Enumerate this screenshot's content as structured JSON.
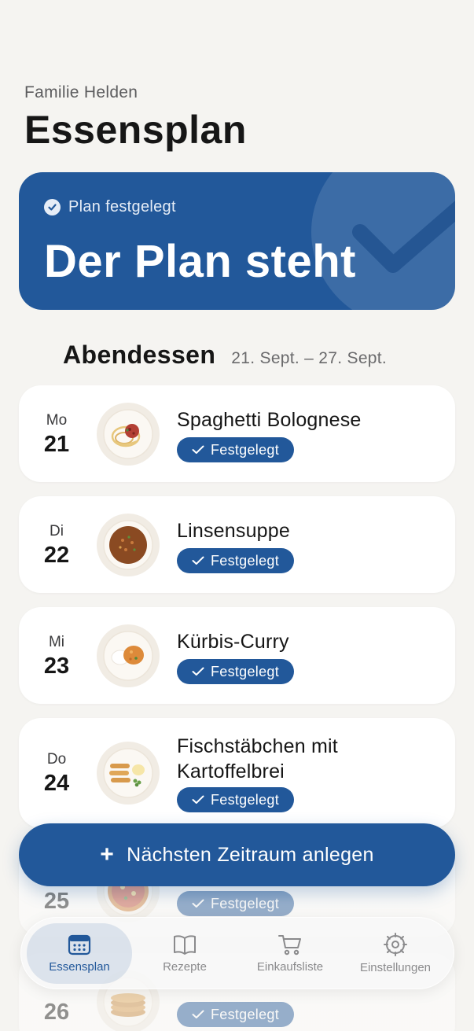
{
  "header": {
    "household": "Familie Helden",
    "title": "Essensplan"
  },
  "hero": {
    "status": "Plan festgelegt",
    "heading": "Der Plan steht"
  },
  "section": {
    "title": "Abendessen",
    "range": "21. Sept. – 27. Sept."
  },
  "meals": [
    {
      "day": "Mo",
      "date": "21",
      "name": "Spaghetti Bolognese",
      "badge": "Festgelegt",
      "plate_icon": "spaghetti-plate-icon"
    },
    {
      "day": "Di",
      "date": "22",
      "name": "Linsensuppe",
      "badge": "Festgelegt",
      "plate_icon": "soup-bowl-icon"
    },
    {
      "day": "Mi",
      "date": "23",
      "name": "Kürbis-Curry",
      "badge": "Festgelegt",
      "plate_icon": "curry-plate-icon"
    },
    {
      "day": "Do",
      "date": "24",
      "name": "Fischstäbchen mit Kartoffelbrei",
      "badge": "Festgelegt",
      "plate_icon": "fish-sticks-plate-icon"
    },
    {
      "day": "",
      "date": "25",
      "name": "",
      "badge": "Festgelegt",
      "plate_icon": "pizza-plate-icon"
    },
    {
      "day": "",
      "date": "26",
      "name": "",
      "badge": "Festgelegt",
      "plate_icon": "pancakes-plate-icon"
    }
  ],
  "cta": {
    "label": "Nächsten Zeitraum anlegen",
    "icon": "plus-icon"
  },
  "tabs": [
    {
      "label": "Essensplan",
      "icon": "calendar-icon",
      "active": true
    },
    {
      "label": "Rezepte",
      "icon": "book-icon",
      "active": false
    },
    {
      "label": "Einkaufsliste",
      "icon": "cart-icon",
      "active": false
    },
    {
      "label": "Einstellungen",
      "icon": "gear-icon",
      "active": false
    }
  ],
  "colors": {
    "accent": "#22589a",
    "background": "#f5f4f1",
    "card": "#ffffff"
  }
}
